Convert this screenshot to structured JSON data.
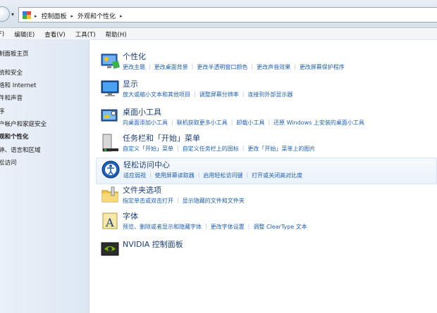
{
  "address_bar": {
    "crumbs": [
      "控制面板",
      "外观和个性化"
    ]
  },
  "menu": [
    "F)",
    "编辑(E)",
    "查看(V)",
    "工具(T)",
    "帮助(H)"
  ],
  "sidebar": {
    "items": [
      {
        "label": "制面板主页",
        "bold": false
      },
      {
        "label": "统和安全",
        "bold": false
      },
      {
        "label": "络和 Internet",
        "bold": false
      },
      {
        "label": "件和声音",
        "bold": false
      },
      {
        "label": "序",
        "bold": false
      },
      {
        "label": "户帐户和家庭安全",
        "bold": false
      },
      {
        "label": "观和个性化",
        "bold": true
      },
      {
        "label": "钟、语言和区域",
        "bold": false
      },
      {
        "label": "松访问",
        "bold": false
      }
    ]
  },
  "categories": [
    {
      "title": "个性化",
      "icon": "personalization-icon",
      "links": [
        "更改主题",
        "更改桌面背景",
        "更改半透明窗口颜色",
        "更改声音效果",
        "更改屏幕保护程序"
      ]
    },
    {
      "title": "显示",
      "icon": "display-icon",
      "links": [
        "放大或缩小文本和其他项目",
        "调整屏幕分辨率",
        "连接到外部显示器"
      ]
    },
    {
      "title": "桌面小工具",
      "icon": "gadgets-icon",
      "links": [
        "向桌面添加小工具",
        "联机获取更多小工具",
        "卸载小工具",
        "还原 Windows 上安装的桌面小工具"
      ]
    },
    {
      "title": "任务栏和「开始」菜单",
      "icon": "taskbar-icon",
      "links": [
        "自定义「开始」菜单",
        "自定义任务栏上的图标",
        "更改「开始」菜单上的图片"
      ]
    },
    {
      "title": "轻松访问中心",
      "icon": "ease-of-access-icon",
      "links": [
        "适应弱视",
        "使用屏幕读取器",
        "启用轻松访问键",
        "打开或关闭高对比度"
      ]
    },
    {
      "title": "文件夹选项",
      "icon": "folder-options-icon",
      "links": [
        "指定单击或双击打开",
        "显示隐藏的文件和文件夹"
      ]
    },
    {
      "title": "字体",
      "icon": "fonts-icon",
      "links": [
        "预览、删除或者显示和隐藏字体",
        "更改字体设置",
        "调整 ClearType 文本"
      ]
    },
    {
      "title": "NVIDIA 控制面板",
      "icon": "nvidia-icon",
      "links": []
    }
  ],
  "colors": {
    "link": "#1f5fb0",
    "title": "#1e3f78",
    "sidebar_bg": "#e3ebf5"
  }
}
